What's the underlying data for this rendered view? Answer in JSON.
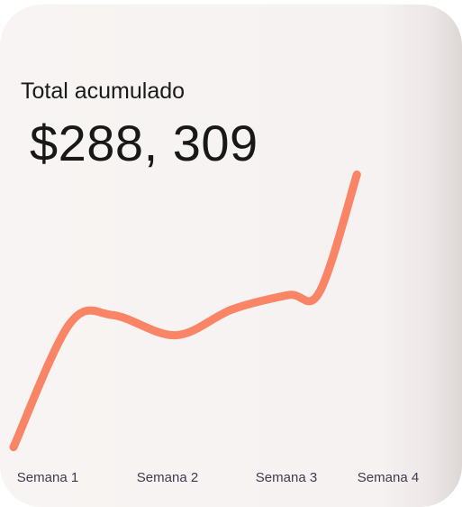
{
  "card": {
    "label": "Total acumulado",
    "total": "$288, 309"
  },
  "colors": {
    "line": "#fa8466",
    "text": "#1a1a1a",
    "tick": "#3f3b4d"
  },
  "chart_data": {
    "type": "line",
    "title": "",
    "xlabel": "",
    "ylabel": "",
    "categories": [
      "Semana 1",
      "Semana 2",
      "Semana 3",
      "Semana 4"
    ],
    "series": [
      {
        "name": "",
        "color": "#fa8466",
        "points": [
          [
            1.0,
            2
          ],
          [
            1.45,
            45
          ],
          [
            1.8,
            48
          ],
          [
            2.3,
            41
          ],
          [
            2.75,
            50
          ],
          [
            3.2,
            55
          ],
          [
            3.45,
            56
          ],
          [
            3.75,
            97
          ]
        ]
      }
    ],
    "xlim": [
      1,
      4
    ],
    "ylim": [
      0,
      100
    ],
    "grid": false,
    "legend": "none"
  }
}
